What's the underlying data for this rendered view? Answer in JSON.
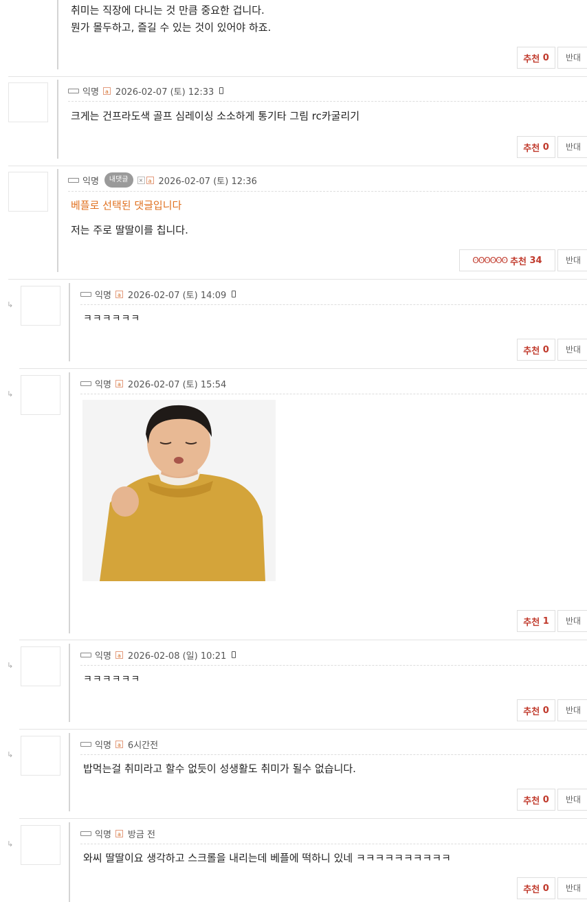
{
  "labels": {
    "up": "추천",
    "down": "반대",
    "mine": "내댓글",
    "best_notice": "베플로 선택된 댓글입니다",
    "user_badge": "a",
    "x_badge": "×",
    "reply_arrow": "↳"
  },
  "comments": [
    {
      "lines": [
        "취미는 직장에 다니는 것 만큼 중요한 겁니다.",
        "뭔가 몰두하고, 즐길 수 있는 것이 있어야 하죠."
      ],
      "up_count": "0"
    },
    {
      "author": "익명",
      "date": "2026-02-07 (토) 12:33",
      "text": "크게는 건프라도색 골프 심레이싱 소소하게 통기타 그림 rc카굴리기",
      "up_count": "0"
    },
    {
      "author": "익명",
      "date": "2026-02-07 (토) 12:36",
      "text": "저는 주로 딸딸이를 칩니다.",
      "up_count": "34",
      "eggs": "ʘʘʘʘʘʘ"
    },
    {
      "author": "익명",
      "date": "2026-02-07 (토) 14:09",
      "text": "ㅋㅋㅋㅋㅋㅋ",
      "up_count": "0"
    },
    {
      "author": "익명",
      "date": "2026-02-07 (토) 15:54",
      "up_count": "1"
    },
    {
      "author": "익명",
      "date": "2026-02-08 (일) 10:21",
      "text": "ㅋㅋㅋㅋㅋㅋ",
      "up_count": "0"
    },
    {
      "author": "익명",
      "date": "6시간전",
      "text": "밥먹는걸 취미라고 할수 없듯이 성생활도 취미가 될수 없습니다.",
      "up_count": "0"
    },
    {
      "author": "익명",
      "date": "방금 전",
      "text": "와씨 딸딸이요 생각하고 스크롤을 내리는데 베플에 떡하니 있네 ㅋㅋㅋㅋㅋㅋㅋㅋㅋㅋ",
      "up_count": "0"
    }
  ]
}
